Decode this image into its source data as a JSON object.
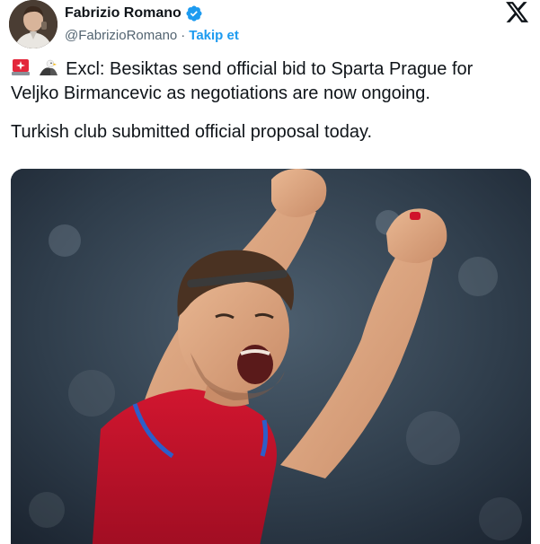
{
  "author": {
    "display_name": "Fabrizio Romano",
    "handle": "@FabrizioRomano",
    "separator": "·",
    "follow_label": "Takip et",
    "verified_color": "#1d9bf0"
  },
  "platform": {
    "logo_icon": "x-logo-icon"
  },
  "tweet": {
    "emojis": [
      "police-siren-emoji-icon",
      "eagle-emoji-icon"
    ],
    "line1": "Excl: Besiktas send official bid to Sparta Prague for",
    "line2": "Veljko Birmancevic as negotiations are now ongoing.",
    "line3": "Turkish club submitted official proposal today."
  },
  "media": {
    "icon": "photo-football-player-celebrating",
    "jersey_color": "#c8102e",
    "trim_color": "#2d5ec9"
  },
  "colors": {
    "text": "#0f1419",
    "secondary": "#536471",
    "link": "#1d9bf0"
  }
}
